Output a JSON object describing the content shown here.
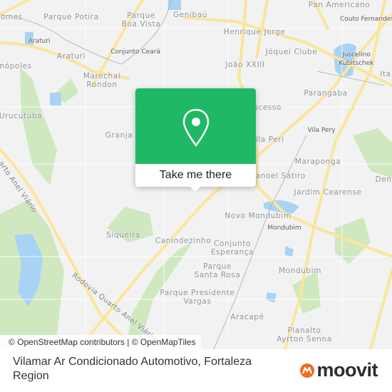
{
  "map": {
    "labels": [
      {
        "text": "Pan Americano",
        "small": false
      },
      {
        "text": "Couto Fernandes",
        "small": true
      },
      {
        "text": "Gomes",
        "small": false
      },
      {
        "text": "Parque Potira",
        "small": false
      },
      {
        "text": "Parque\nBoa Vista",
        "small": false
      },
      {
        "text": "Genibaú",
        "small": false
      },
      {
        "text": "Henrique Jorge",
        "small": false
      },
      {
        "text": "Araturi",
        "small": true
      },
      {
        "text": "Conjunto Ceará",
        "small": true
      },
      {
        "text": "Araturi",
        "small": false
      },
      {
        "text": "Jóquei Clube",
        "small": false
      },
      {
        "text": "Juscelino\nKubitschek",
        "small": true
      },
      {
        "text": "Ita",
        "small": false
      },
      {
        "text": "nópoles",
        "small": false
      },
      {
        "text": "João XXIII",
        "small": false
      },
      {
        "text": "Marechal\nRondon",
        "small": false
      },
      {
        "text": "Parangaba",
        "small": false
      },
      {
        "text": "ucesso",
        "small": false
      },
      {
        "text": "Urucutuba",
        "small": false
      },
      {
        "text": "Vila Pery",
        "small": true
      },
      {
        "text": "Granja",
        "small": false
      },
      {
        "text": "Vila Peri",
        "small": false
      },
      {
        "text": "Maraponga",
        "small": false
      },
      {
        "text": "Manoel Sátiro",
        "small": false
      },
      {
        "text": "Den",
        "small": false
      },
      {
        "text": "Jardim Cearense",
        "small": false
      },
      {
        "text": "Novo Mondubim",
        "small": false
      },
      {
        "text": "Mondubim",
        "small": true
      },
      {
        "text": "Siqueira",
        "small": false
      },
      {
        "text": "Canindezinho",
        "small": false
      },
      {
        "text": "Conjunto\nEsperança",
        "small": false
      },
      {
        "text": "Parque\nSanta Rosa",
        "small": false
      },
      {
        "text": "Mondubim",
        "small": false
      },
      {
        "text": "Parque Presidente\nVargas",
        "small": false
      },
      {
        "text": "Aracapé",
        "small": false
      },
      {
        "text": "Planalto\nAyrton Senna",
        "small": false
      }
    ],
    "road_labels": [
      "arto Anel Viário",
      "Rodovia Quarto Anel Viário"
    ],
    "colors": {
      "background": "#f2f2f3",
      "major_road": "#fbe59a",
      "park": "#cfe8c0",
      "water": "#a9d3f5"
    }
  },
  "popup": {
    "icon": "location-pin-icon",
    "button_label": "Take me there",
    "color": "#1fb866"
  },
  "attribution": "© OpenStreetMap contributors | © OpenMapTiles",
  "footer": {
    "title": "Vilamar Ar Condicionado Automotivo, Fortaleza Region",
    "logo": "moovit",
    "logo_color": "#f26b21"
  }
}
